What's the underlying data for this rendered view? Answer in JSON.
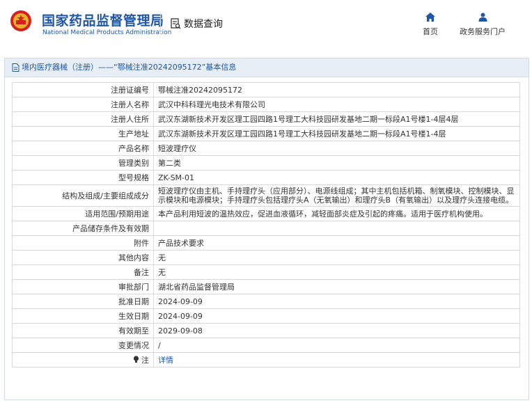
{
  "header": {
    "org_cn": "国家药品监督管理局",
    "org_en": "National Medical Products Administration",
    "query_label": "数据查询",
    "nav": [
      {
        "label": "首页",
        "icon": "home-icon"
      },
      {
        "label": "政务服务门户",
        "icon": "user-icon"
      }
    ]
  },
  "breadcrumb": "境内医疗器械（注册）——“鄂械注准20242095172”基本信息",
  "rows": [
    {
      "label": "注册证编号",
      "value": "鄂械注准20242095172"
    },
    {
      "label": "注册人名称",
      "value": "武汉中科科理光电技术有限公司"
    },
    {
      "label": "注册人住所",
      "value": "武汉东湖新技术开发区理工园四路1号理工大科技园研发基地二期一标段A1号楼1-4层4层"
    },
    {
      "label": "生产地址",
      "value": "武汉东湖新技术开发区理工园四路1号理工大科技园研发基地二期一标段A1号楼1-4层"
    },
    {
      "label": "产品名称",
      "value": "短波理疗仪"
    },
    {
      "label": "管理类别",
      "value": "第二类"
    },
    {
      "label": "型号规格",
      "value": "ZK-SM-01"
    },
    {
      "label": "结构及组成/主要组成成分",
      "value": "短波理疗仪由主机、手持理疗头（应用部分）、电源线组成；其中主机包括机箱、制氧模块、控制模块、显示模块和电源模块；手持理疗头包括理疗头A（无氧输出）和理疗头B（有氧输出）以及理疗头连接电缆。"
    },
    {
      "label": "适用范围/预期用途",
      "value": "本产品利用短波的温热效应，促进血液循环，减轻面部炎症及引起的疼痛。适用于医疗机构使用。"
    },
    {
      "label": "产品储存条件及有效期",
      "value": ""
    },
    {
      "label": "附件",
      "value": "产品技术要求"
    },
    {
      "label": "其他内容",
      "value": "无"
    },
    {
      "label": "备注",
      "value": "无"
    },
    {
      "label": "审批部门",
      "value": "湖北省药品监督管理局"
    },
    {
      "label": "批准日期",
      "value": "2024-09-09"
    },
    {
      "label": "生效日期",
      "value": "2024-09-09"
    },
    {
      "label": "有效期至",
      "value": "2029-09-08"
    },
    {
      "label": "变更情况",
      "value": "/"
    },
    {
      "label": "注",
      "value": "详情"
    }
  ]
}
